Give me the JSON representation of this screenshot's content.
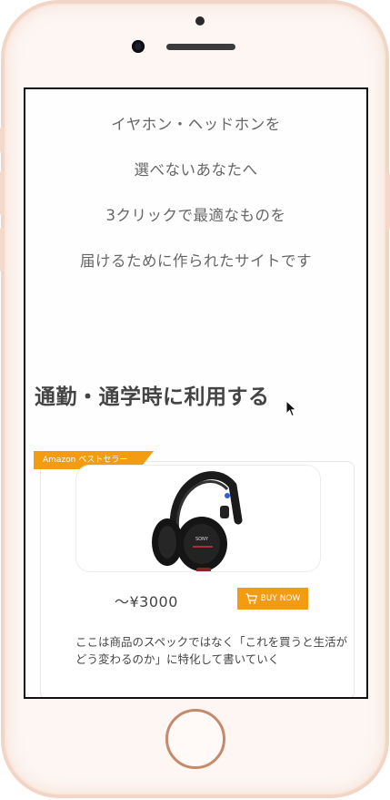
{
  "intro": {
    "line1": "イヤホン・ヘッドホンを",
    "line2": "選べないあなたへ",
    "line3": "3クリックで最適なものを",
    "line4": "届けるために作られたサイトです"
  },
  "section": {
    "title": "通勤・通学時に利用する"
  },
  "product": {
    "badge": "Amazon ベストセラー",
    "price": "〜¥3000",
    "buy_label": "BUY NOW",
    "description": "ここは商品のスペックではなく「これを買うと生活がどう変わるのか」に特化して書いていく",
    "image_brand": "SONY",
    "image_icon": "headphones-image"
  },
  "colors": {
    "accent": "#f39c12",
    "frame": "#f1d6c8",
    "text": "#444444"
  }
}
